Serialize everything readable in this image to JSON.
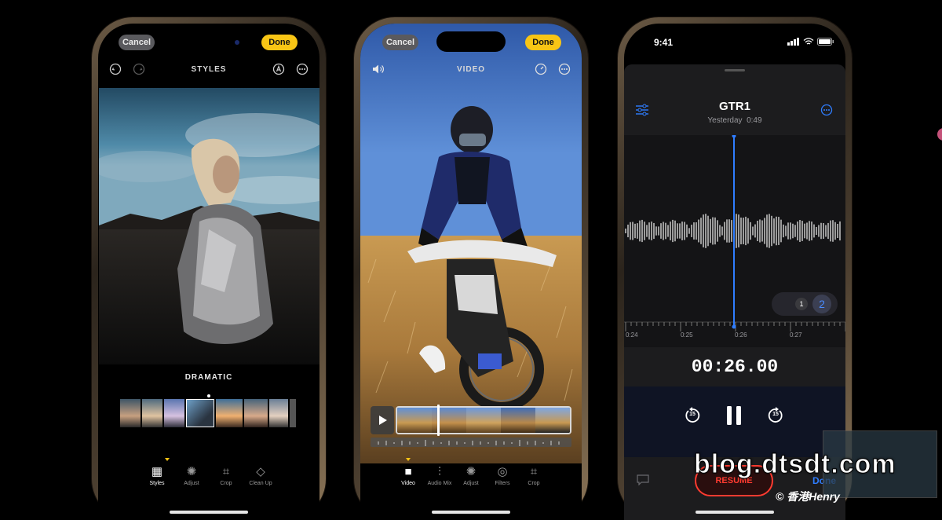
{
  "phone1": {
    "cancel": "Cancel",
    "done": "Done",
    "title": "STYLES",
    "style_name": "DRAMATIC",
    "tabs": [
      {
        "label": "Styles",
        "icon": "grid-icon"
      },
      {
        "label": "Adjust",
        "icon": "dial-icon"
      },
      {
        "label": "Crop",
        "icon": "crop-icon"
      },
      {
        "label": "Clean Up",
        "icon": "eraser-icon"
      }
    ]
  },
  "phone2": {
    "cancel": "Cancel",
    "done": "Done",
    "title": "VIDEO",
    "tabs": [
      {
        "label": "Video",
        "icon": "video-camera-icon"
      },
      {
        "label": "Audio Mix",
        "icon": "waveform-person-icon"
      },
      {
        "label": "Adjust",
        "icon": "dial-icon"
      },
      {
        "label": "Filters",
        "icon": "filters-icon"
      },
      {
        "label": "Crop",
        "icon": "crop-icon"
      }
    ]
  },
  "phone3": {
    "time": "9:41",
    "recording_title": "GTR1",
    "date": "Yesterday",
    "duration": "0:49",
    "ticks": [
      "0:24",
      "0:25",
      "0:26",
      "0:27"
    ],
    "layers": [
      "1",
      "2"
    ],
    "timer": "00:26.00",
    "resume": "RESUME",
    "done": "Done",
    "skip_back": "15",
    "skip_fwd": "15"
  },
  "watermark": {
    "site": "blog.dtsdt.com",
    "credit": "© 香港Henry"
  },
  "colors": {
    "accent_yellow": "#f8c515",
    "voice_blue": "#2f7dff",
    "resume_red": "#ff3b30"
  }
}
